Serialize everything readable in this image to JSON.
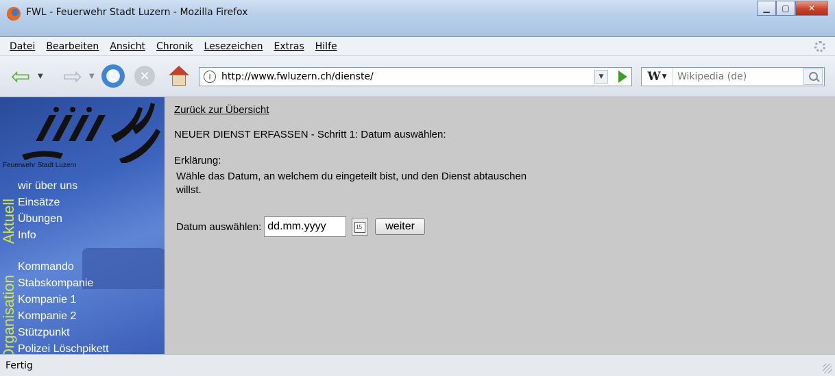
{
  "window": {
    "title": "FWL - Feuerwehr Stadt Luzern - Mozilla Firefox"
  },
  "menubar": {
    "items": [
      "Datei",
      "Bearbeiten",
      "Ansicht",
      "Chronik",
      "Lesezeichen",
      "Extras",
      "Hilfe"
    ]
  },
  "navbar": {
    "url": "http://www.fwluzern.ch/dienste/",
    "search_engine": "W",
    "search_placeholder": "Wikipedia (de)"
  },
  "sidebar": {
    "logo_caption": "Feuerwehr Stadt Luzern",
    "aktuell": {
      "heading": "Aktuell",
      "links": [
        "wir über uns",
        "Einsätze",
        "Übungen",
        "Info"
      ]
    },
    "organisation": {
      "heading": "Organisation",
      "links": [
        "Kommando",
        "Stabskompanie",
        "Kompanie 1",
        "Kompanie 2",
        "Stützpunkt",
        "Polizei Löschpikett"
      ]
    }
  },
  "main": {
    "back_link": "Zurück zur Übersicht",
    "step_title": "NEUER DIENST ERFASSEN - Schritt 1: Datum auswählen:",
    "explanation_label": "Erklärung:",
    "explanation_text": "Wähle das Datum, an welchem du eingeteilt bist, und den Dienst abtauschen willst.",
    "date_label": "Datum auswählen:",
    "date_value": "dd.mm.yyyy",
    "submit_label": "weiter"
  },
  "statusbar": {
    "text": "Fertig"
  },
  "colors": {
    "sidebar_blue": "#3c63bc",
    "section_heading": "#d6e640",
    "content_bg": "#c9c9c9"
  }
}
